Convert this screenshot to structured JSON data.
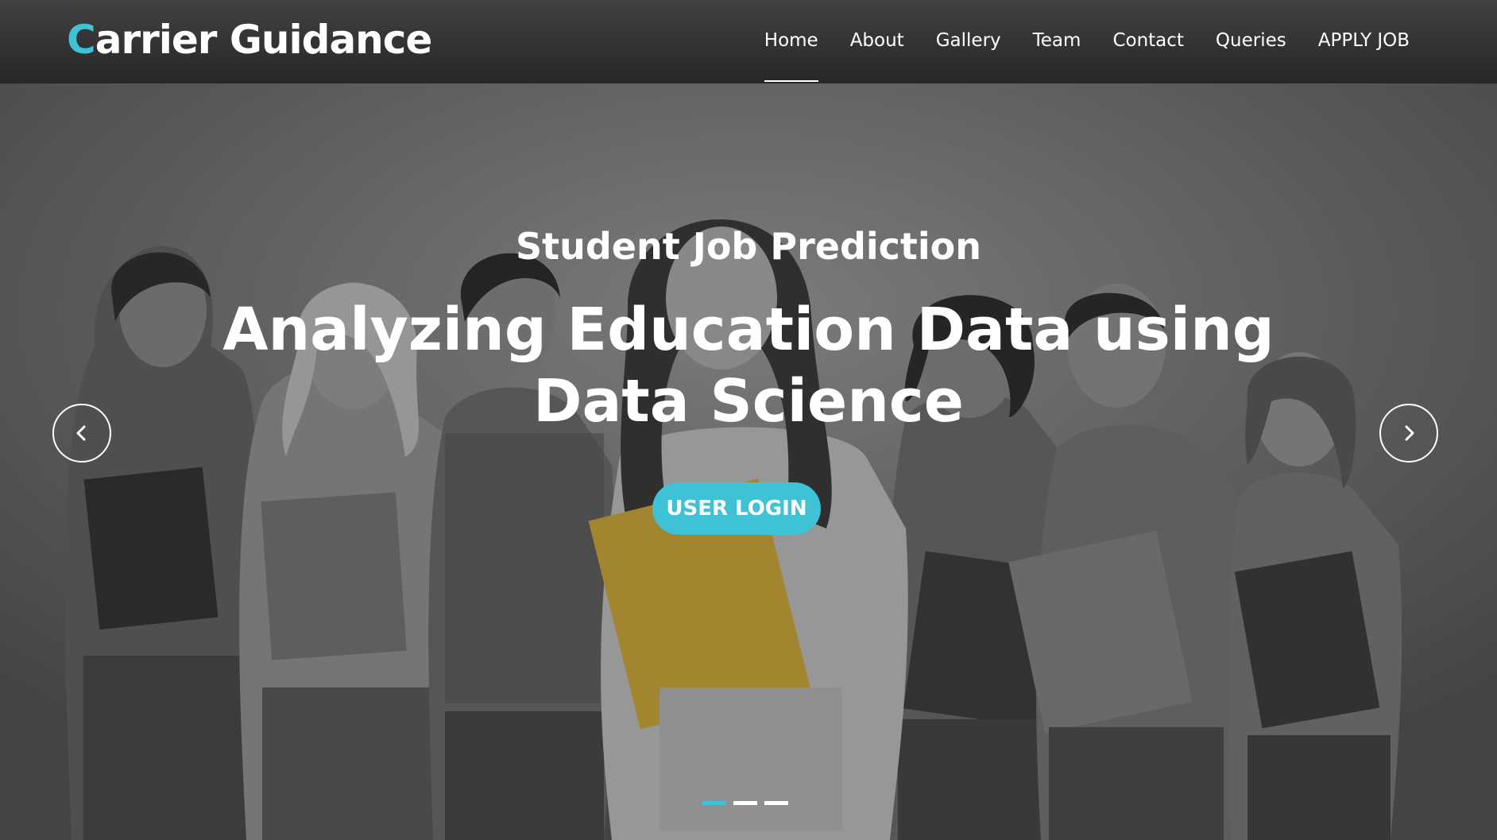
{
  "brand": {
    "first_letter": "C",
    "rest": "arrier Guidance",
    "accent": "#3fc1d6"
  },
  "nav": {
    "items": [
      {
        "label": "Home",
        "active": true
      },
      {
        "label": "About"
      },
      {
        "label": "Gallery"
      },
      {
        "label": "Team"
      },
      {
        "label": "Contact"
      },
      {
        "label": "Queries"
      },
      {
        "label": "APPLY JOB"
      }
    ]
  },
  "hero": {
    "subtitle": "Student Job Prediction",
    "title": "Analyzing Education Data using Data Science",
    "button": "USER LOGIN",
    "prev_icon": "chevron-left-icon",
    "next_icon": "chevron-right-icon",
    "slides": 3,
    "active_slide": 1
  }
}
